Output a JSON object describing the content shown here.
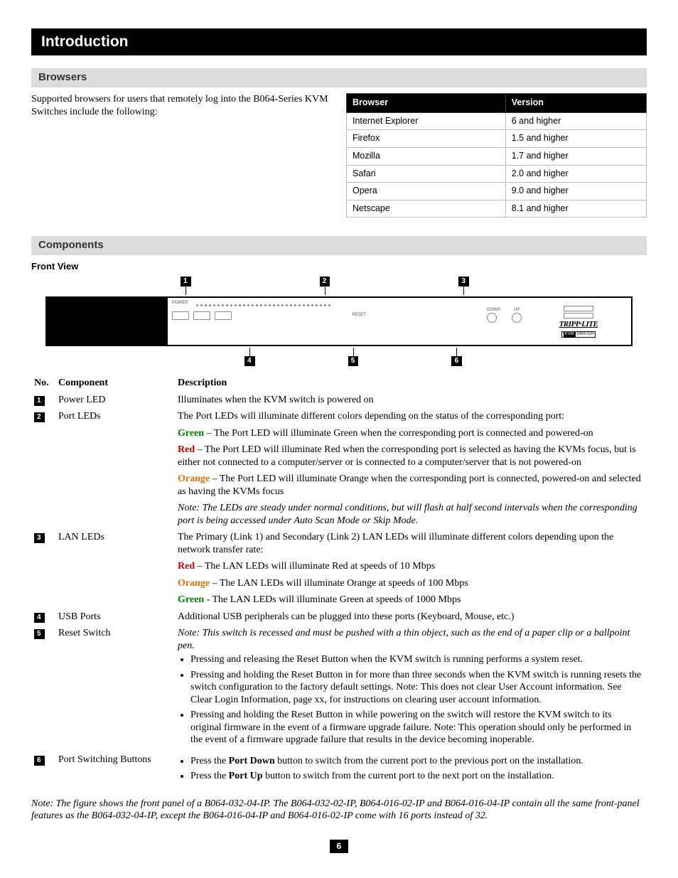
{
  "page_number": "6",
  "title": "Introduction",
  "browsers": {
    "heading": "Browsers",
    "intro": "Supported browsers for users that remotely log into the B064-Series KVM Switches include the following:",
    "col_browser": "Browser",
    "col_version": "Version",
    "rows": [
      {
        "browser": "Internet Explorer",
        "version": "6 and higher"
      },
      {
        "browser": "Firefox",
        "version": "1.5 and higher"
      },
      {
        "browser": "Mozilla",
        "version": "1.7 and higher"
      },
      {
        "browser": "Safari",
        "version": "2.0 and higher"
      },
      {
        "browser": "Opera",
        "version": "9.0 and higher"
      },
      {
        "browser": "Netscape",
        "version": "8.1 and higher"
      }
    ]
  },
  "components": {
    "heading": "Components",
    "front_view_label": "Front View",
    "diagram": {
      "power_label": "POWER",
      "reset_label": "RESET",
      "down_label": "DOWN",
      "up_label": "UP",
      "brand": "TRIPP·LITE",
      "kvm_left": "KVM",
      "kvm_right": "SWITCH"
    },
    "cols": {
      "no": "No.",
      "component": "Component",
      "desc": "Description"
    },
    "rows": {
      "r1": {
        "num": "1",
        "name": "Power LED",
        "desc": "Illuminates when the KVM switch is powered on"
      },
      "r2": {
        "num": "2",
        "name": "Port LEDs",
        "intro": "The Port LEDs will illuminate different colors depending on the status of the corresponding port:",
        "green_label": "Green",
        "green_text": " – The Port LED will illuminate Green when the corresponding port is connected and powered-on",
        "red_label": "Red",
        "red_text": " – The Port LED will illuminate Red when the corresponding port is selected as having the KVMs focus, but is either not connected to a computer/server or is connected to a computer/server that is not powered-on",
        "orange_label": "Orange",
        "orange_text": " – The Port LED will illuminate Orange when the corresponding port is connected, powered-on and selected as having the KVMs focus",
        "note": "Note: The LEDs are steady under normal conditions, but will flash at half second intervals when the corresponding port is being accessed under Auto Scan Mode or Skip Mode."
      },
      "r3": {
        "num": "3",
        "name": "LAN LEDs",
        "intro": "The Primary (Link 1) and Secondary (Link 2) LAN LEDs will illuminate different colors depending upon the network transfer rate:",
        "red_label": "Red",
        "red_text": " – The LAN LEDs will illuminate Red at speeds of 10 Mbps",
        "orange_label": "Orange",
        "orange_text": " – The LAN LEDs will illuminate Orange at speeds of 100 Mbps",
        "green_label": "Green",
        "green_text": " - The LAN LEDs will illuminate Green at speeds of 1000 Mbps"
      },
      "r4": {
        "num": "4",
        "name": "USB Ports",
        "desc": "Additional USB peripherals can be plugged into these ports (Keyboard, Mouse, etc.)"
      },
      "r5": {
        "num": "5",
        "name": "Reset Switch",
        "note": "Note: This switch is recessed and must be pushed with a thin object, such as the end of a paper clip or a ballpoint pen.",
        "b1": "Pressing and releasing the Reset Button when the KVM switch is running performs a system reset.",
        "b2": "Pressing and holding the Reset Button in for more than three seconds when the KVM switch is running resets the switch configuration to the factory default settings. Note: This does not clear User Account information. See Clear Login Information, page xx, for instructions on clearing user account information.",
        "b3": "Pressing and holding the Reset Button in while powering on the switch will restore the KVM switch to its original firmware in the event of a firmware upgrade failure. Note: This operation should only be performed in the event of a firmware upgrade failure that results in the device becoming inoperable."
      },
      "r6": {
        "num": "6",
        "name": "Port Switching Buttons",
        "b1_pre": "Press the ",
        "b1_bold": "Port Down",
        "b1_post": " button to switch from the current port to the previous port on the installation.",
        "b2_pre": "Press the ",
        "b2_bold": "Port Up",
        "b2_post": " button to switch from the current port to the next port on the installation."
      }
    },
    "footer_note": "Note: The figure shows the front panel of a B064-032-04-IP. The B064-032-02-IP, B064-016-02-IP and B064-016-04-IP contain all the same front-panel features as the B064-032-04-IP, except the B064-016-04-IP and B064-016-02-IP come with 16 ports instead of 32."
  }
}
